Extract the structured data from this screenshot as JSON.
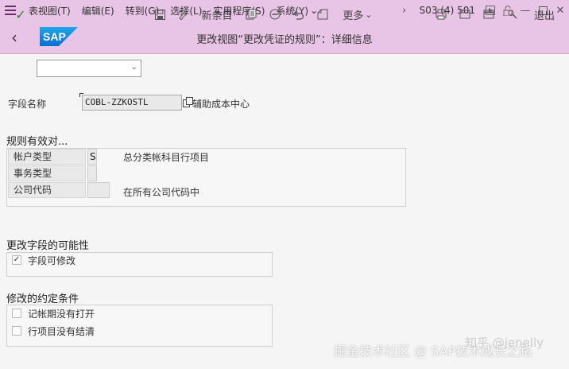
{
  "menubar": {
    "items": [
      "表视图(T)",
      "编辑(E)",
      "转到(G)",
      "选择(L)",
      "实用程序(S)",
      "系统(Y)"
    ],
    "more_chevron": "⌄",
    "system_info": "S03 (4) 501"
  },
  "titlebar": {
    "logo_text": "SAP",
    "title": "更改视图“更改凭证的规则”：详细信息"
  },
  "toolbar": {
    "command_value": "",
    "new_entries": "新条目",
    "more": "更多",
    "exit": "退出"
  },
  "form": {
    "field_label": "字段名称",
    "field_value": "COBL-ZZKOSTL",
    "field_desc": "辅助成本中心"
  },
  "rule_section": {
    "title": "规则有效对...",
    "rows": [
      {
        "label": "帐户类型",
        "value": "S",
        "desc": "总分类帐科目行项目"
      },
      {
        "label": "事务类型",
        "value": "",
        "desc": ""
      },
      {
        "label": "公司代码",
        "value": "",
        "desc": "在所有公司代码中"
      }
    ]
  },
  "modifiable_section": {
    "title": "更改字段的可能性",
    "checkbox_label": "字段可修改",
    "checked": true
  },
  "conditions_section": {
    "title": "修改的约定条件",
    "items": [
      {
        "label": "记帐期没有打开",
        "checked": false
      },
      {
        "label": "行项目没有结清",
        "checked": false
      }
    ]
  },
  "watermarks": {
    "line1": "知乎 @jenelly",
    "line2": "掘金技术社区 @ SAP技术成长之路"
  },
  "colors": {
    "header_bg": "#e8c4e6",
    "sap_blue": "#0a6ed1",
    "check_green": "#2e8b2e"
  }
}
